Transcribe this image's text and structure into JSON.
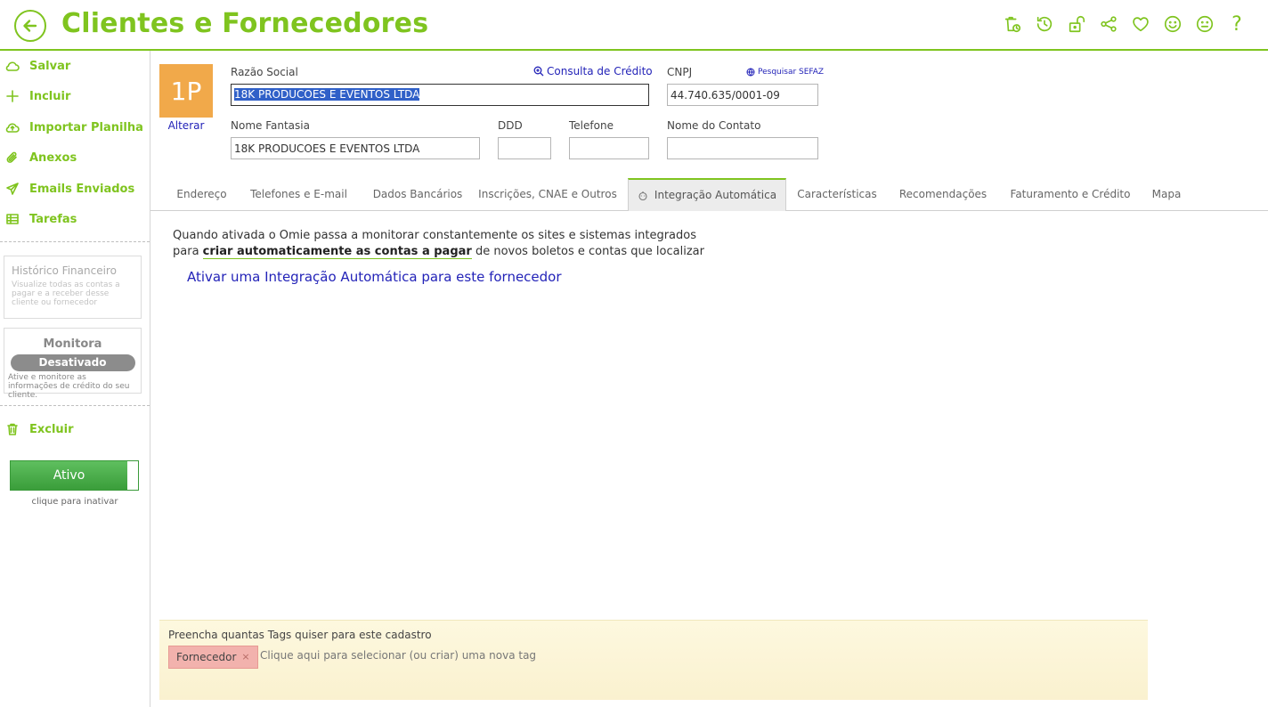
{
  "header": {
    "title": "Clientes e Fornecedores",
    "icons": [
      "trash-clock-icon",
      "history-icon",
      "unlock-icon",
      "share-icon",
      "heart-icon",
      "smile-icon",
      "neutral-face-icon",
      "help-icon"
    ],
    "help_glyph": "?"
  },
  "colors": {
    "brand_green": "#7fc41f",
    "link_blue": "#2323b8",
    "avatar_orange": "#f1a94a",
    "active_green": "#3a9d3a",
    "tag_red": "#f2b2ad"
  },
  "sidebar": {
    "items": [
      {
        "label": "Salvar",
        "icon": "cloud-icon"
      },
      {
        "label": "Incluir",
        "icon": "plus-icon"
      },
      {
        "label": "Importar Planilha",
        "icon": "cloud-upload-icon"
      },
      {
        "label": "Anexos",
        "icon": "paperclip-icon"
      },
      {
        "label": "Emails Enviados",
        "icon": "send-icon"
      },
      {
        "label": "Tarefas",
        "icon": "table-icon"
      }
    ],
    "historico": {
      "title": "Histórico Financeiro",
      "desc": "Visualize todas as contas a pagar e a receber desse cliente ou fornecedor"
    },
    "monitora": {
      "title": "Monitora",
      "toggle": "Desativado",
      "desc": "Ative e monitore as informações de crédito do seu cliente."
    },
    "excluir": "Excluir",
    "status": {
      "label": "Ativo",
      "hint": "clique para inativar"
    }
  },
  "form": {
    "avatar_text": "1P",
    "alterar": "Alterar",
    "razao_social": {
      "label": "Razão Social",
      "value": "18K PRODUCOES E EVENTOS LTDA"
    },
    "consulta_credito": "Consulta de Crédito",
    "cnpj": {
      "label": "CNPJ",
      "value": "44.740.635/0001-09"
    },
    "pesquisar_sefaz": "Pesquisar SEFAZ",
    "nome_fantasia": {
      "label": "Nome Fantasia",
      "value": "18K PRODUCOES E EVENTOS LTDA"
    },
    "ddd": {
      "label": "DDD",
      "value": ""
    },
    "telefone": {
      "label": "Telefone",
      "value": ""
    },
    "nome_contato": {
      "label": "Nome do Contato",
      "value": ""
    }
  },
  "tabs": [
    {
      "label": "Endereço"
    },
    {
      "label": "Telefones e E-mail"
    },
    {
      "label": "Dados Bancários"
    },
    {
      "label": "Inscrições, CNAE e Outros"
    },
    {
      "label": "Integração Automática",
      "active": true
    },
    {
      "label": "Características"
    },
    {
      "label": "Recomendações"
    },
    {
      "label": "Faturamento e Crédito"
    },
    {
      "label": "Mapa"
    }
  ],
  "content": {
    "line1": "Quando ativada o Omie passa a monitorar constantemente os sites e sistemas integrados",
    "line2_prefix": "para ",
    "line2_bold": "criar automaticamente as contas a pagar",
    "line2_suffix": " de novos boletos e contas que localizar",
    "activate_link": "Ativar uma Integração Automática para este fornecedor"
  },
  "tags": {
    "title": "Preencha quantas Tags quiser para este cadastro",
    "items": [
      "Fornecedor"
    ],
    "remove_glyph": "×",
    "placeholder": "Clique aqui para selecionar (ou criar) uma nova tag"
  }
}
